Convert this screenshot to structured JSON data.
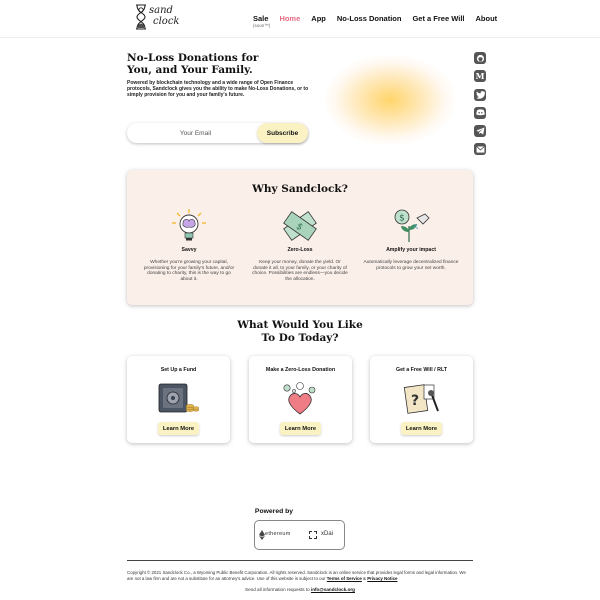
{
  "header": {
    "logo_text_line1": "sand",
    "logo_text_line2": "clock",
    "nav": [
      {
        "label": "Sale",
        "note": "(soon™)"
      },
      {
        "label": "Home"
      },
      {
        "label": "App"
      },
      {
        "label": "No-Loss Donation"
      },
      {
        "label": "Get a Free Will"
      },
      {
        "label": "About"
      }
    ]
  },
  "hero": {
    "title": "No-Loss Donations for You, and Your Family.",
    "description": "Powered by blockchain technology and a wide range of Open Finance protocols, Sandclock gives you the ability to make No-Loss Donations, or to simply provision for you and your family's future.",
    "email_placeholder": "Your Email",
    "subscribe_label": "Subscribe"
  },
  "social": [
    "github-icon",
    "medium-icon",
    "twitter-icon",
    "discord-icon",
    "telegram-icon",
    "email-icon"
  ],
  "why": {
    "title": "Why Sandclock?",
    "features": [
      {
        "title": "Savvy",
        "desc": "Whether you're growing your capital, provisioning for your family's future, and/or donating to charity, this is the way to go about it."
      },
      {
        "title": "Zero-Loss",
        "desc": "Keep your money, donate the yield. Or donate it all, to your family, or your charity of choice. Possibilities are endless—you decide the allocation."
      },
      {
        "title": "Amplify your impact",
        "desc": "Automatically leverage decentralized finance protocols to grow your net worth."
      }
    ]
  },
  "what": {
    "title_line1": "What Would You Like",
    "title_line2": "To Do Today?",
    "cards": [
      {
        "title": "Set Up a Fund",
        "button": "Learn More"
      },
      {
        "title": "Make a Zero-Loss Donation",
        "button": "Learn More"
      },
      {
        "title": "Get a Free Will / RLT",
        "button": "Learn More"
      }
    ]
  },
  "powered": {
    "label": "Powered by",
    "eth": "ethereum",
    "xdai": "xDai"
  },
  "footer": {
    "text": "Copyright © 2021 Sandclock Co., a Wyoming Public Benefit Corporation. All rights reserved. Sandclock is an online service that provides legal forms and legal information. We are not a law firm and are not a substitute for an attorney's advice. Use of this website is subject to our",
    "terms": "Terms of Service",
    "amp": " & ",
    "privacy": "Privacy Notice",
    "contact": "Send all information requests to",
    "email": "info@sandclock.org"
  },
  "colors": {
    "active_nav": "#e56e85",
    "button_bg": "#fbf2c4",
    "why_bg": "#fbefe9"
  }
}
